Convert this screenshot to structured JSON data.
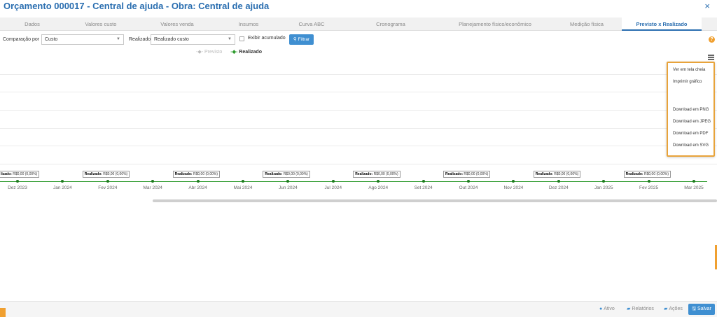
{
  "window": {
    "title": "Orçamento 000017 - Central de ajuda - Obra: Central de ajuda",
    "close_icon": "×"
  },
  "tabs": [
    {
      "label": "Dados"
    },
    {
      "label": "Valores custo"
    },
    {
      "label": "Valores venda"
    },
    {
      "label": "Insumos"
    },
    {
      "label": "Curva ABC"
    },
    {
      "label": "Cronograma"
    },
    {
      "label": "Planejamento físico/econômico"
    },
    {
      "label": "Medição física"
    },
    {
      "label": "Previsto x Realizado",
      "active": true
    }
  ],
  "filters": {
    "comparacao_label": "Comparação por",
    "comparacao_value": "Custo",
    "realizado_label": "Realizado",
    "realizado_value": "Realizado custo",
    "acumulado_label": "Exibir acumulado",
    "acumulado_checked": false,
    "filter_button": "Filtrar",
    "filter_icon": "search-icon"
  },
  "chart_data": {
    "type": "line",
    "legend": [
      {
        "name": "Previsto",
        "color": "#bbbbbb"
      },
      {
        "name": "Realizado",
        "color": "#2e9b2e"
      }
    ],
    "x": [
      "Dez 2023",
      "Jan 2024",
      "Fev 2024",
      "Mar 2024",
      "Abr 2024",
      "Mai 2024",
      "Jun 2024",
      "Jul 2024",
      "Ago 2024",
      "Set 2024",
      "Out 2024",
      "Nov 2024",
      "Dez 2024",
      "Jan 2025",
      "Fev 2025",
      "Mar 2025"
    ],
    "series": [
      {
        "name": "Realizado",
        "values": [
          0,
          0,
          0,
          0,
          0,
          0,
          0,
          0,
          0,
          0,
          0,
          0,
          0,
          0,
          0,
          0
        ]
      }
    ],
    "data_label_prefix": "Realizado:",
    "data_label_value": "R$0,00 (0,00%)",
    "data_label_value_cut": "lizado:"
  },
  "export_menu": {
    "items": [
      "Ver em tela cheia",
      "Imprimir gráfico",
      "Download em PNG",
      "Download em JPEG",
      "Download em PDF",
      "Download em SVG"
    ]
  },
  "bottom": {
    "ativo": "Ativo",
    "relatorios": "Relatórios",
    "acoes": "Ações",
    "salvar": "Salvar"
  },
  "help_icon": "?"
}
